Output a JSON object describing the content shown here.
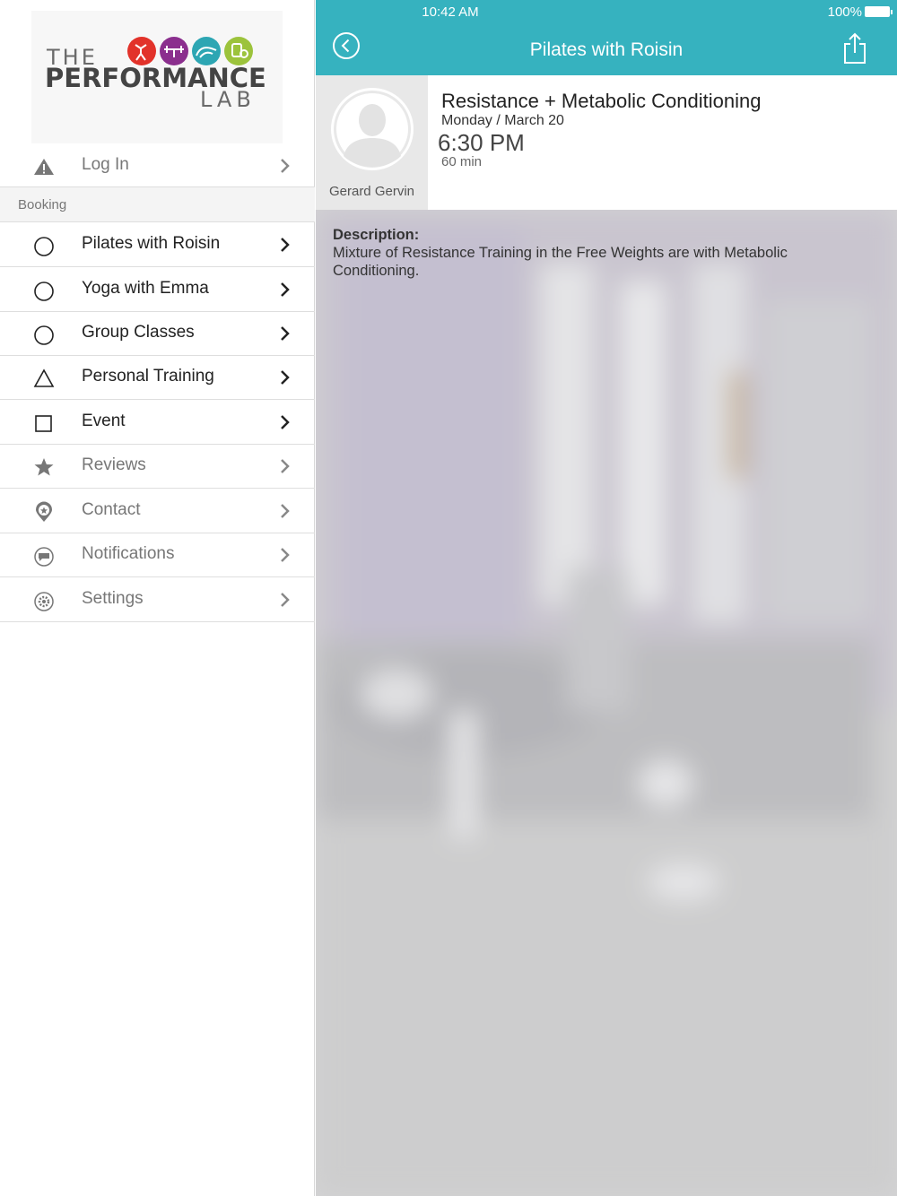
{
  "status_bar": {
    "time": "10:42 AM",
    "battery": "100%"
  },
  "logo": {
    "line1": "THE",
    "line2": "PERFORMANCE",
    "line3": "LAB",
    "circle_colors": [
      "#e2322a",
      "#8b2f8e",
      "#2da6b3",
      "#9cc33c"
    ]
  },
  "sidebar": {
    "login": {
      "label": "Log In",
      "icon": "warning-icon"
    },
    "section_booking": "Booking",
    "items": [
      {
        "label": "Pilates with Roisin",
        "icon": "circle-icon"
      },
      {
        "label": "Yoga with Emma",
        "icon": "circle-icon"
      },
      {
        "label": "Group Classes",
        "icon": "circle-icon"
      },
      {
        "label": "Personal Training",
        "icon": "triangle-icon"
      },
      {
        "label": "Event",
        "icon": "square-icon"
      },
      {
        "label": "Reviews",
        "icon": "star-icon"
      },
      {
        "label": "Contact",
        "icon": "location-pin-icon"
      },
      {
        "label": "Notifications",
        "icon": "chat-bubble-icon"
      },
      {
        "label": "Settings",
        "icon": "gear-icon"
      }
    ]
  },
  "header": {
    "title": "Pilates with Roisin",
    "accent": "#36b2bf"
  },
  "class": {
    "trainer": "Gerard Gervin",
    "title": "Resistance + Metabolic Conditioning",
    "date": "Monday / March 20",
    "time": "6:30 PM",
    "duration": "60 min",
    "description_label": "Description:",
    "description": "Mixture of Resistance Training in the Free Weights are with Metabolic Conditioning."
  }
}
